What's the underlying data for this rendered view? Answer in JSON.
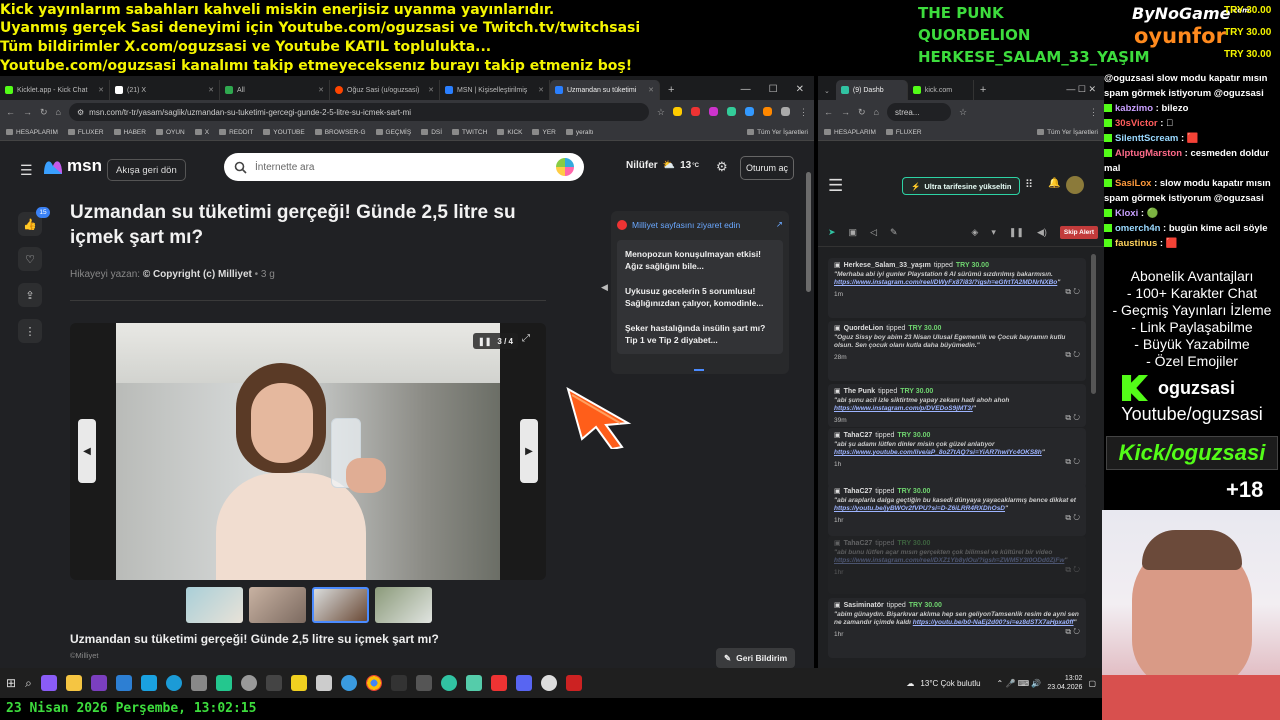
{
  "ticker": {
    "line1": "Kick yayınlarım sabahları kahveli miskin enerjisiz uyanma yayınlarıdır.",
    "line2": "Uyanmış gerçek Sasi deneyimi için Youtube.com/oguzsasi ve Twitch.tv/twitchsasi",
    "line3": "Tüm bildirimler X.com/oguzsasi ve Youtube KATIL toplulukta...",
    "line4": "Youtube.com/oguzsasi kanalımı takip etmeyeceksenız burayı takip etmeniz boş!"
  },
  "overlay": {
    "names": [
      "THE PUNK",
      "QUORDELION",
      "HERKESE_SALAM_33_YAŞIM"
    ],
    "brand1": "ByNoGame",
    "brand1_sup": ".com",
    "brand2": "oyunfor",
    "tips": [
      "TRY 30.00",
      "TRY 30.00",
      "TRY 30.00"
    ],
    "bottom_date": "23 Nisan 2026 Perşembe, 13:02:15"
  },
  "browser_left": {
    "tabs": [
      "Kicklet.app - Kick Chat",
      "(21) X",
      "All",
      "Oğuz Sasi (u/oguzsasi)",
      "MSN | Kişiselleştirilmiş",
      "Uzmandan su tüketimi"
    ],
    "url": "msn.com/tr-tr/yasam/saglik/uzmandan-su-tuketimi-gercegi-gunde-2-5-litre-su-icmek-sart-mi",
    "bookmarks": [
      "HESAPLARIM",
      "FLUXER",
      "HABER",
      "OYUN",
      "X",
      "REDDIT",
      "YOUTUBE",
      "BROWSER-G",
      "GEÇMİŞ",
      "DSİ",
      "TWITCH",
      "KICK",
      "YER",
      "yeraltı"
    ],
    "bookmarks_right": "Tüm Yer İşaretleri"
  },
  "msn": {
    "logo": "msn",
    "back_button": "Akışa geri dön",
    "search_placeholder": "İnternette ara",
    "city": "Nilüfer",
    "temp": "13",
    "temp_unit": "°C",
    "signin": "Oturum aç",
    "notif_count": "15",
    "title": "Uzmandan su tüketimi gerçeği! Günde 2,5 litre su içmek şart mı?",
    "byline_prefix": "Hikayeyi yazan:",
    "byline_source": "© Copyright (c) Milliyet",
    "byline_age": "• 3 g",
    "slide_counter": "3 / 4",
    "caption": "Uzmandan su tüketimi gerçeği! Günde 2,5 litre su içmek şart mı?",
    "credit": "©Milliyet",
    "feedback": "Geri Bildirim",
    "side_link": "Milliyet sayfasını ziyaret edin",
    "side_items": [
      "Menopozun konuşulmayan etkisi! Ağız sağlığını bile...",
      "Uykusuz gecelerin 5 sorumlusu! Sağlığınızdan çalıyor, komodinle...",
      "Şeker hastalığında insülin şart mı? Tip 1 ve Tip 2 diyabet..."
    ]
  },
  "browser_right": {
    "tabs": [
      "(9) Dashb",
      "kick.com"
    ],
    "url": "strea...",
    "bookmarks": [
      "HESAPLARIM",
      "FLUXER"
    ],
    "bookmarks_right": "Tüm Yer İşaretleri",
    "upgrade": "Ultra tarifesine yükseltin",
    "skip": "Skip Alert",
    "donations": [
      {
        "name": "Herkese_Salam_33_yaşım",
        "verb": "tipped",
        "amount": "TRY 30.00",
        "msg": "\"Merhaba abi iyi gunler Playstation 6 AI sürümü sızdırılmış bakarmısın. ",
        "link": "https://www.instagram.com/reel/DWyFx87i83/?igsh=eGfrtTA2MDNrNXBo",
        "tail": "\"",
        "time": "1m",
        "dim": false
      },
      {
        "name": "QuordeLion",
        "verb": "tipped",
        "amount": "TRY 30.00",
        "msg": "\"Oguz Sissy boy abim 23 Nisan Ulusal Egemenlik ve Çocuk bayramın kutlu olsun. Sen çocuk olanı kutla daha büyümedin.\"",
        "link": "",
        "tail": "",
        "time": "28m",
        "dim": false
      },
      {
        "name": "The Punk",
        "verb": "tipped",
        "amount": "TRY 30.00",
        "msg": "\"abi şunu acil izle siktirtme yapay zekanı hadi ahoh ahoh ",
        "link": "https://www.instagram.com/p/DVEDoS9jMT3/",
        "tail": "\"",
        "time": "39m",
        "dim": false
      },
      {
        "name": "TahaC27",
        "verb": "tipped",
        "amount": "TRY 30.00",
        "msg": "\"abi şu adamı lütfen dinler misin çok güzel anlatıyor ",
        "link": "https://www.youtube.com/live/aP_8o27tAQ?si=YiAR7hwIYc4OKS8h",
        "tail": "\"",
        "time": "1h",
        "dim": false
      },
      {
        "name": "TahaC27",
        "verb": "tipped",
        "amount": "TRY 30.00",
        "msg": "\"abi araplarla dalga geçtiğin bu kasedi dünyaya yayacaklarmış bence dikkat et ",
        "link": "https://youtu.be/jyBWOr2fVPU?si=D-Z6iLRR4RXDhOsD",
        "tail": "\"",
        "time": "1hr",
        "dim": false
      },
      {
        "name": "TahaC27",
        "verb": "tipped",
        "amount": "TRY 30.00",
        "msg": "\"abi bunu lütfen açar mısın gerçekten çok bilimsel ve kültürel bir video ",
        "link": "https://www.instagram.com/reel/DXZ1Yb8yIOu/?igsh=ZWM5Y3I0ODd0ZjFw",
        "tail": "\"",
        "time": "1hr",
        "dim": true
      },
      {
        "name": "Sasiminatör",
        "verb": "tipped",
        "amount": "TRY 30.00",
        "msg": "\"abim günaydın. Bişarkıvar aklıma hep sen geliyonTamsenlik resim de ayni sen ne zamandır içimde kaldı ",
        "link": "https://youtu.be/b0-NaEj2d00?si=ez8dSTX7aHpxa0ff",
        "tail": "\"",
        "time": "1hr",
        "dim": false
      }
    ]
  },
  "chat": {
    "messages": [
      {
        "user": "@oguzsasi",
        "text": "slow modu kapatır mısın spam görmek istiyorum @oguzsasi",
        "badge": false
      },
      {
        "user": "kabzimo",
        "text": ": bilezo",
        "badge": true
      },
      {
        "user": "30sVictor",
        "text": ": 🏻",
        "badge": true
      },
      {
        "user": "SilenttScream",
        "text": ": 🟥",
        "badge": true
      },
      {
        "user": "AlptugMarston",
        "text": ": cesmeden doldur mal",
        "badge": true
      },
      {
        "user": "SasiLox",
        "text": ": slow modu kapatır mısın spam görmek istiyorum @oguzsasi",
        "badge": true
      },
      {
        "user": "Kloxi",
        "text": ": 🟢",
        "badge": true
      },
      {
        "user": "omerch4n",
        "text": ": bugün kime acil söyle",
        "badge": true
      },
      {
        "user": "faustinus",
        "text": ": 🟥",
        "badge": true
      }
    ],
    "sub_title": "Abonelik Avantajları",
    "sub_items": [
      "- 100+ Karakter Chat",
      "- Geçmiş Yayınları İzleme",
      "- Link Paylaşabilme",
      "- Büyük Yazabilme",
      "- Özel Emojiler"
    ],
    "kick_name": "oguzsasi",
    "yt": "Youtube/oguzsasi",
    "kick_banner": "Kick/oguzsasi",
    "age": "+18"
  },
  "taskbar": {
    "weather": "13°C  Çok bulutlu",
    "time": "13:02",
    "date": "23.04.2026"
  }
}
